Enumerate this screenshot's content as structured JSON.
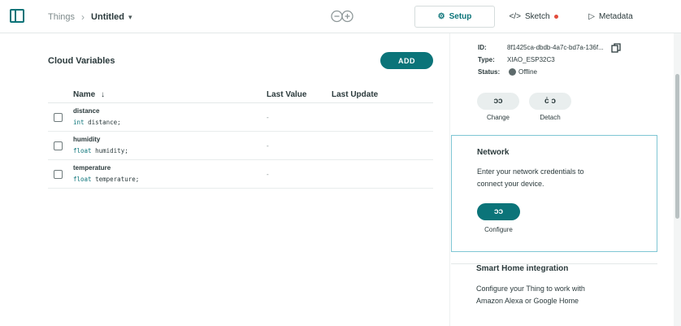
{
  "breadcrumb": {
    "root": "Things",
    "current": "Untitled"
  },
  "tabs": {
    "setup": "Setup",
    "sketch": "Sketch",
    "metadata": "Metadata"
  },
  "cloud_variables": {
    "title": "Cloud Variables",
    "add_label": "ADD",
    "columns": {
      "name": "Name",
      "last_value": "Last Value",
      "last_update": "Last Update"
    },
    "rows": [
      {
        "name": "distance",
        "type": "int",
        "decl": "distance;",
        "last_value": "-"
      },
      {
        "name": "humidity",
        "type": "float",
        "decl": "humidity;",
        "last_value": "-"
      },
      {
        "name": "temperature",
        "type": "float",
        "decl": "temperature;",
        "last_value": "-"
      }
    ]
  },
  "device": {
    "id_label": "ID:",
    "id_value": "8f1425ca-dbdb-4a7c-bd7a-136f...",
    "type_label": "Type:",
    "type_value": "XIAO_ESP32C3",
    "status_label": "Status:",
    "status_value": "Offline",
    "change_label": "Change",
    "detach_label": "Detach"
  },
  "network": {
    "title": "Network",
    "text_line1": "Enter your network credentials to",
    "text_line2": "connect your device.",
    "configure_label": "Configure"
  },
  "smart_home": {
    "title": "Smart Home integration",
    "text_line1": "Configure your Thing to work with",
    "text_line2": "Amazon Alexa or Google Home"
  },
  "colors": {
    "accent": "#0b7479",
    "sketch_dot": "#e24b3b",
    "focus_border": "#7fc6d4"
  }
}
